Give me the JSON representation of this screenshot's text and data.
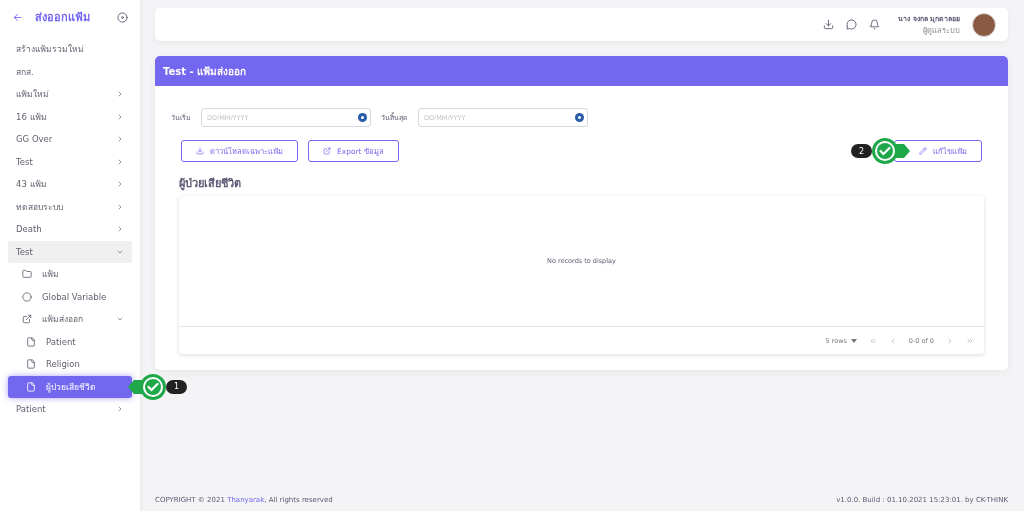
{
  "sidebar": {
    "title": "ส่งออกแฟ้ม",
    "items": [
      {
        "label": "สร้างแฟ้มรวมใหม่",
        "selected": false
      },
      {
        "label": "สกส.",
        "selected": false
      },
      {
        "label": "แฟ้มใหม่",
        "selected": false,
        "expanded": false
      },
      {
        "label": "16 แฟ้ม",
        "selected": false,
        "expanded": false
      },
      {
        "label": "GG Over",
        "selected": false,
        "expanded": false
      },
      {
        "label": "Test",
        "selected": false,
        "expanded": false
      },
      {
        "label": "43 แฟ้ม",
        "selected": false,
        "expanded": false
      },
      {
        "label": "ทดสอบระบบ",
        "selected": false,
        "expanded": false
      },
      {
        "label": "Death",
        "selected": false,
        "expanded": false
      },
      {
        "label": "Test",
        "selected": false,
        "expanded": true,
        "children": [
          {
            "label": "แฟ้ม",
            "kind": "folder",
            "selected": false
          },
          {
            "label": "Global Variable",
            "kind": "circle",
            "selected": false
          },
          {
            "label": "แฟ้มส่งออก",
            "kind": "export",
            "selected": false,
            "expanded": true,
            "children": [
              {
                "label": "Patient",
                "kind": "file",
                "selected": false
              },
              {
                "label": "Religion",
                "kind": "file",
                "selected": false
              },
              {
                "label": "ผู้ป่วยเสียชีวิต",
                "kind": "file",
                "selected": true
              }
            ]
          }
        ]
      },
      {
        "label": "Patient",
        "selected": false,
        "expanded": false
      }
    ]
  },
  "header": {
    "user_name": "นาง จงกล มุกดาลอย",
    "user_role": "ผู้ดูแลระบบ"
  },
  "card": {
    "title": "Test - แฟ้มส่งออก",
    "start_label": "วันเริ่ม",
    "start_placeholder": "DD/MM/YYYY",
    "end_label": "วันสิ้นสุด",
    "end_placeholder": "DD/MM/YYYY",
    "buttons": [
      "ดาวน์โหลดเฉพาะแฟ้ม",
      "Export ข้อมูล"
    ],
    "edit_button": "แก้ไขแฟ้ม",
    "section_title": "ผู้ป่วยเสียชีวิต",
    "empty_text": "No records to display",
    "pagination": {
      "rows": "5 rows",
      "range": "0-0 of 0"
    }
  },
  "callouts": [
    {
      "label": "1"
    },
    {
      "label": "2"
    }
  ],
  "footer": {
    "copyright": "COPYRIGHT © 2021 ",
    "brand": "Thanyarak",
    "rights": ", All rights reserved",
    "version": "v1.0.0. Build : 01.10.2021 15:23:01. by CK-THINK"
  }
}
